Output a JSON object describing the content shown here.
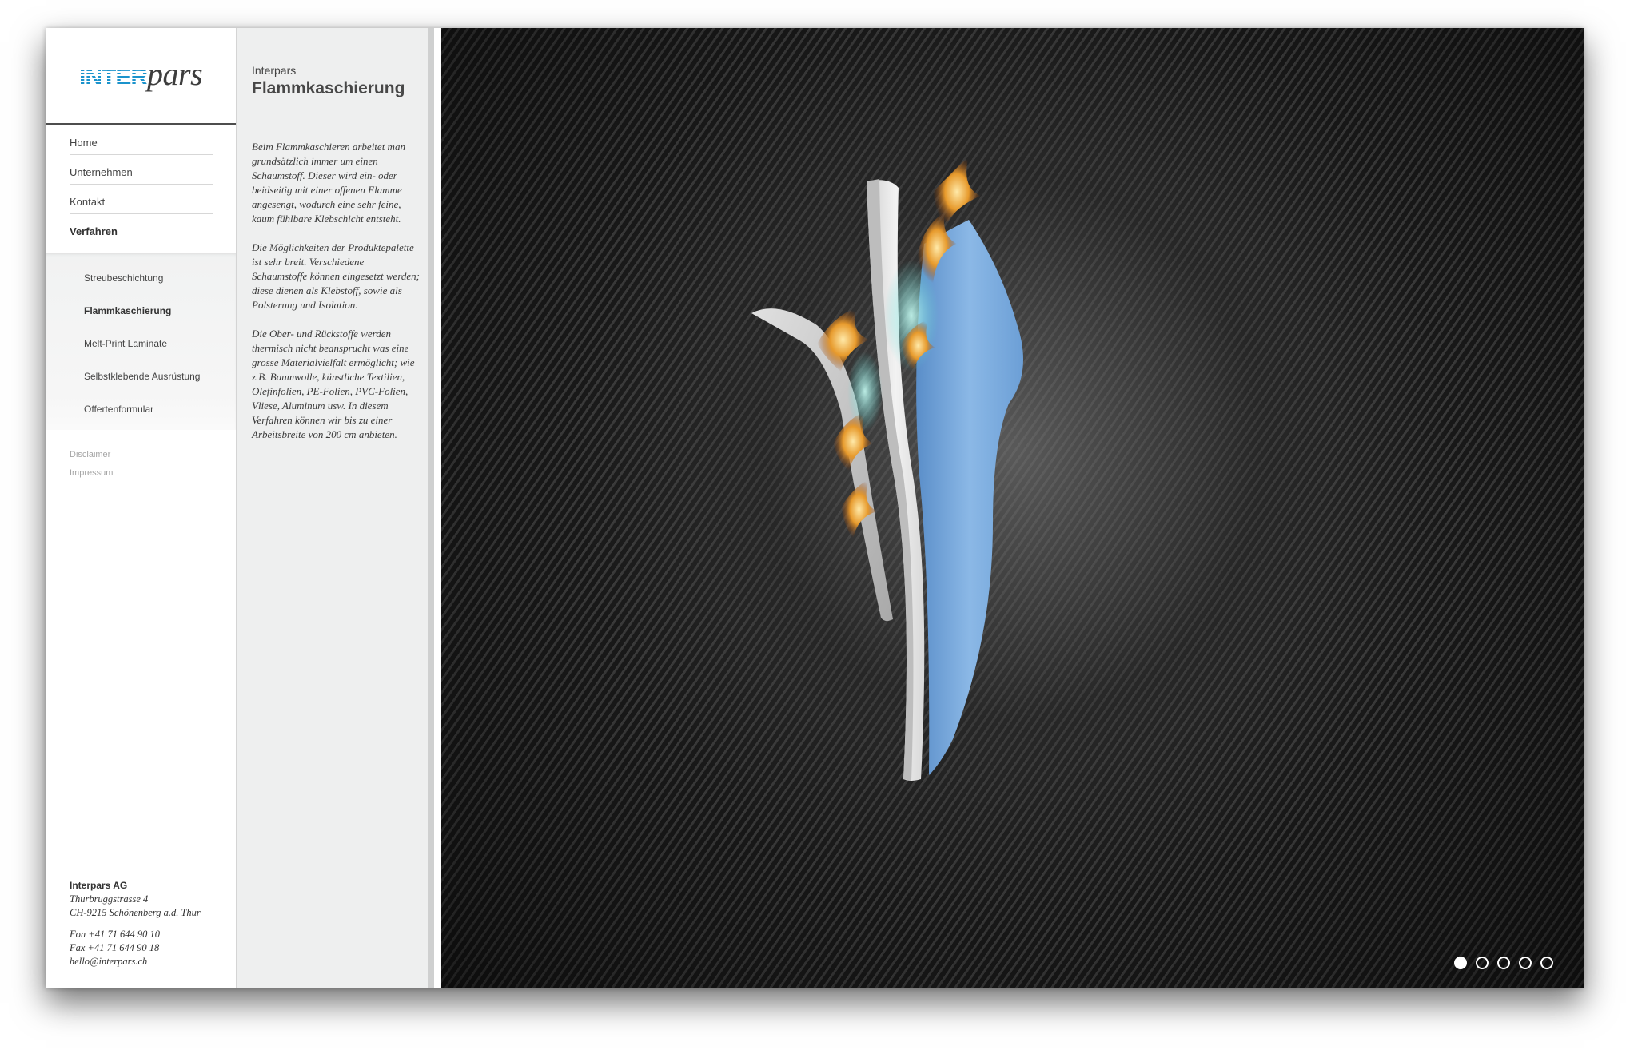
{
  "brand": {
    "logo_part1": "INTER",
    "logo_part2": "pars"
  },
  "nav": {
    "main": [
      {
        "label": "Home"
      },
      {
        "label": "Unternehmen"
      },
      {
        "label": "Kontakt"
      },
      {
        "label": "Verfahren"
      }
    ],
    "sub": [
      {
        "label": "Streubeschichtung"
      },
      {
        "label": "Flammkaschierung"
      },
      {
        "label": "Melt-Print Laminate"
      },
      {
        "label": "Selbstklebende Ausrüstung"
      },
      {
        "label": "Offertenformular"
      }
    ],
    "legal": [
      {
        "label": "Disclaimer"
      },
      {
        "label": "Impressum"
      }
    ]
  },
  "address": {
    "company": "Interpars AG",
    "street": "Thurbruggstrasse 4",
    "city": "CH-9215 Schönenberg a.d. Thur",
    "phone": "Fon +41 71 644 90 10",
    "fax": "Fax +41 71 644 90 18",
    "email": "hello@interpars.ch"
  },
  "content": {
    "kicker": "Interpars",
    "title": "Flammkaschierung",
    "paragraphs": [
      "Beim Flammkaschieren arbeitet man grundsätzlich immer um einen Schaumstoff. Dieser wird ein- oder beidseitig mit einer offenen Flamme angesengt, wodurch eine sehr feine, kaum fühlbare Klebschicht entsteht.",
      "Die Möglichkeiten der Produktepalette ist sehr breit. Verschiedene Schaumstoffe können eingesetzt werden; diese dienen als Klebstoff, sowie als Polsterung und Isolation.",
      "Die Ober- und Rückstoffe werden thermisch nicht beansprucht was eine grosse Materialvielfalt ermöglicht; wie z.B. Baumwolle, künstliche Textilien, Olefinfolien, PE-Folien, PVC-Folien, Vliese, Aluminum usw. In diesem Verfahren können wir bis zu einer Arbeitsbreite von 200 cm anbieten."
    ]
  },
  "slider": {
    "count": 5,
    "active": 1
  },
  "colors": {
    "accent": "#1f9fd4",
    "stage_bg": "#1c1c1c",
    "foam_blue": "#7aaee0"
  }
}
